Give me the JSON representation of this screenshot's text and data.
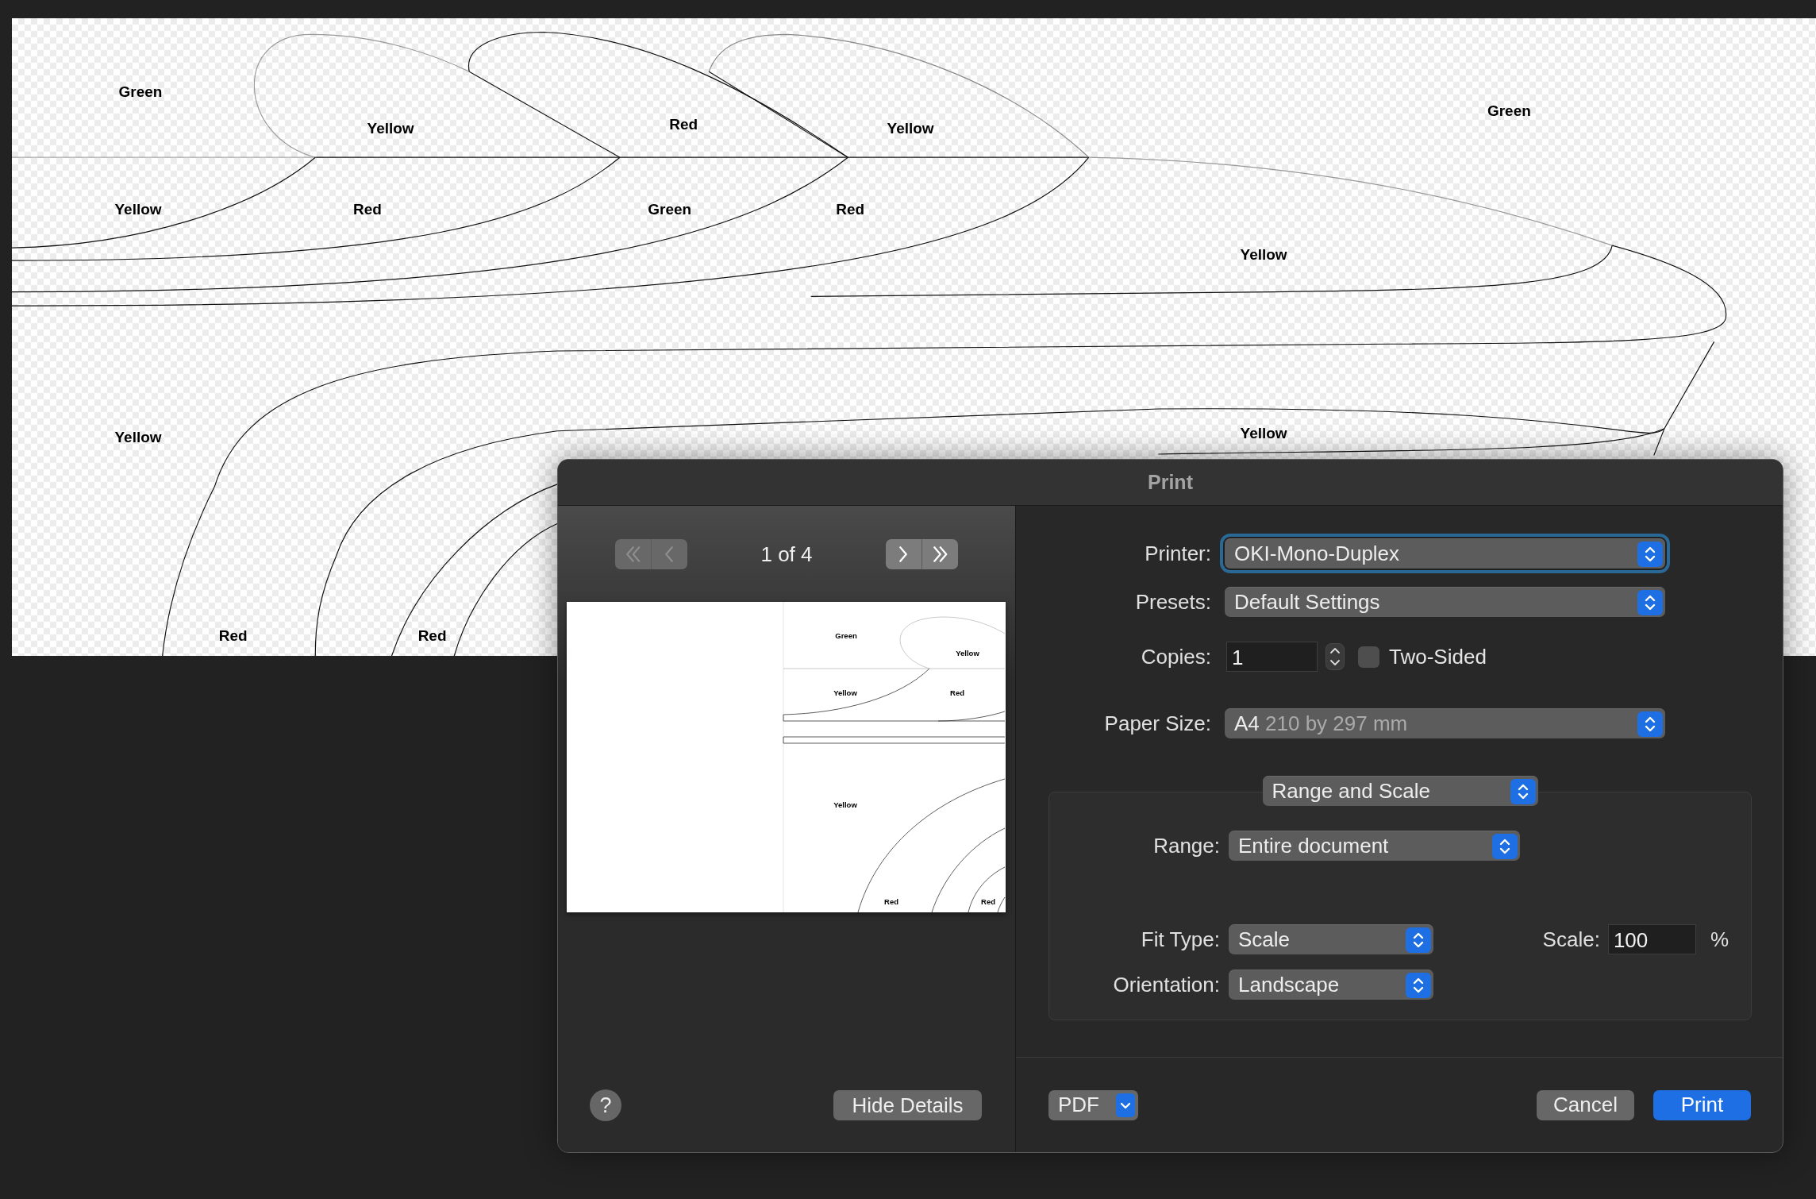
{
  "canvas": {
    "labels": [
      "Green",
      "Yellow",
      "Red",
      "Yellow",
      "Green",
      "Yellow",
      "Red",
      "Green",
      "Red",
      "Yellow",
      "Yellow",
      "Yellow",
      "Red",
      "Red"
    ]
  },
  "dialog": {
    "title": "Print",
    "preview": {
      "page_indicator": "1 of 4",
      "nav_buttons": [
        {
          "kind": "first",
          "disabled": true
        },
        {
          "kind": "previous",
          "disabled": true
        },
        {
          "kind": "next",
          "disabled": false
        },
        {
          "kind": "last",
          "disabled": false
        }
      ],
      "page_labels": [
        "Green",
        "Yellow",
        "Yellow",
        "Red",
        "Yellow",
        "Red",
        "Red"
      ]
    },
    "help_button": "?",
    "hide_details_button": "Hide Details",
    "printer": {
      "label": "Printer:",
      "value": "OKI-Mono-Duplex",
      "focused": true
    },
    "presets": {
      "label": "Presets:",
      "value": "Default Settings"
    },
    "copies": {
      "label": "Copies:",
      "value": "1"
    },
    "two_sided": {
      "label": "Two-Sided",
      "checked": false
    },
    "paper_size": {
      "label": "Paper Size:",
      "value": "A4",
      "detail": "210 by 297 mm"
    },
    "section": "Range and Scale",
    "range": {
      "label": "Range:",
      "value": "Entire document"
    },
    "fit_type": {
      "label": "Fit Type:",
      "value": "Scale"
    },
    "scale": {
      "label": "Scale:",
      "value": "100",
      "unit": "%"
    },
    "orientation": {
      "label": "Orientation:",
      "value": "Landscape"
    },
    "pdf_button": "PDF",
    "cancel_button": "Cancel",
    "print_button": "Print"
  }
}
